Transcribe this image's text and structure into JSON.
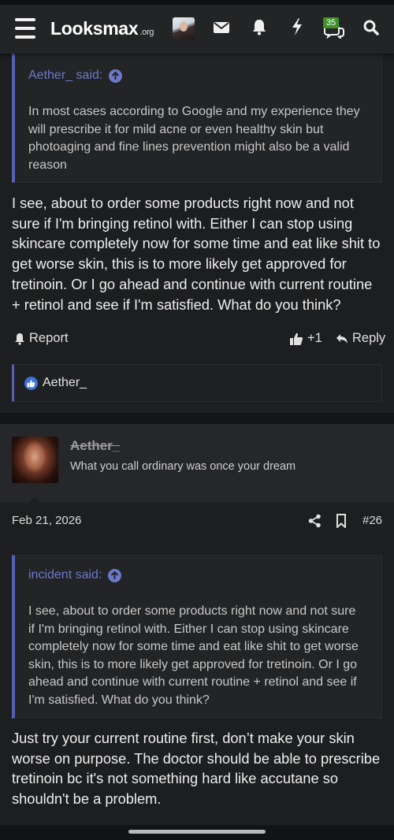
{
  "header": {
    "site_name": "Looksmax",
    "site_tld": ".org",
    "icons": [
      "hamburger-menu-icon",
      "user-avatar",
      "envelope-icon",
      "bell-icon",
      "lightning-icon",
      "chat-bubbles-icon",
      "search-icon"
    ],
    "chat_badge": "35"
  },
  "post1": {
    "quote": {
      "author": "Aether_ said:",
      "text": "In most cases according to Google and my experience they will prescribe it for mild acne or even healthy skin but photoaging and fine lines prevention might also be a valid reason"
    },
    "body": "I see, about to order some products right now and not sure if I'm bringing retinol with. Either I can stop using skincare completely now for some time and eat like shit to get worse skin, this is to more likely get approved for tretinoin. Or I go ahead and continue with current routine + retinol and see if I'm satisfied. What do you think?",
    "report_label": "Report",
    "like_label": "+1",
    "reply_label": "Reply",
    "reactions_user": "Aether_"
  },
  "post2": {
    "username": "Aether_",
    "user_title": "What you call ordinary was once your dream",
    "date": "Feb 21, 2026",
    "post_number": "#26",
    "quote": {
      "author": "incident said:",
      "text": "I see, about to order some products right now and not sure if I'm bringing retinol with. Either I can stop using skincare completely now for some time and eat like shit to get worse skin, this is to more likely get approved for tretinoin. Or I go ahead and continue with current routine + retinol and see if I'm satisfied. What do you think?"
    },
    "body": "Just try your current routine first, don’t make your skin worse on purpose. The doctor should be able to prescribe tretinoin bc it's not something hard like accutane so shouldn't be a problem."
  },
  "colors": {
    "background": "#1d1e20",
    "header": "#232425",
    "quote_accent": "#5561b5",
    "quote_author": "#6c79c9",
    "badge": "#3f8f29",
    "like": "#3a73d6"
  }
}
